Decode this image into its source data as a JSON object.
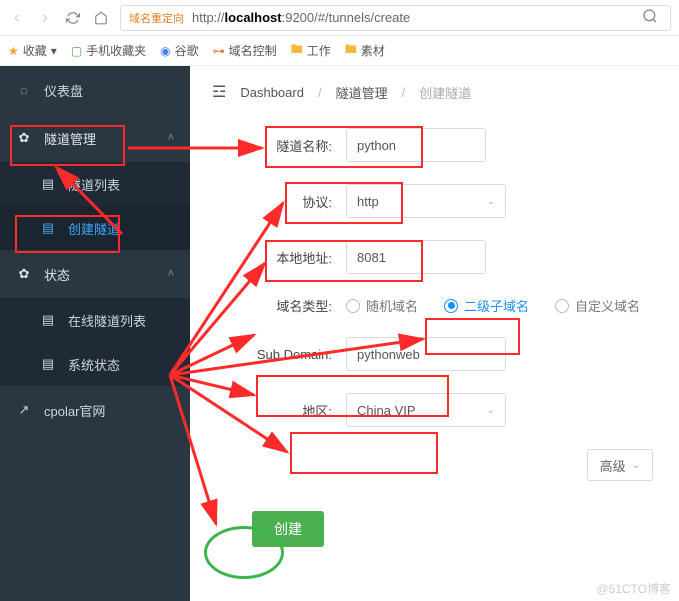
{
  "browser": {
    "url_tag": "域名重定向",
    "url_prefix": "http://",
    "url_host": "localhost",
    "url_port_path": ":9200/#/tunnels/create"
  },
  "bookmarks": {
    "favorites": "收藏",
    "mobile": "手机收藏夹",
    "google": "谷歌",
    "domain_ctrl": "域名控制",
    "work": "工作",
    "asset": "素材"
  },
  "sidebar": {
    "dashboard": "仪表盘",
    "tunnel_mgmt": "隧道管理",
    "tunnel_list": "隧道列表",
    "tunnel_create": "创建隧道",
    "status": "状态",
    "online_list": "在线隧道列表",
    "system_status": "系统状态",
    "cpolar_site": "cpolar官网"
  },
  "breadcrumb": {
    "a": "Dashboard",
    "b": "隧道管理",
    "c": "创建隧道"
  },
  "form": {
    "name_label": "隧道名称:",
    "name_value": "python",
    "protocol_label": "协议:",
    "protocol_value": "http",
    "local_addr_label": "本地地址:",
    "local_addr_value": "8081",
    "domain_type_label": "域名类型:",
    "domain_random": "随机域名",
    "domain_sub": "二级子域名",
    "domain_custom": "自定义域名",
    "subdomain_label": "Sub Domain:",
    "subdomain_value": "pythonweb",
    "region_label": "地区:",
    "region_value": "China VIP",
    "advanced": "高级",
    "submit": "创建"
  },
  "watermark": "@51CTO博客"
}
